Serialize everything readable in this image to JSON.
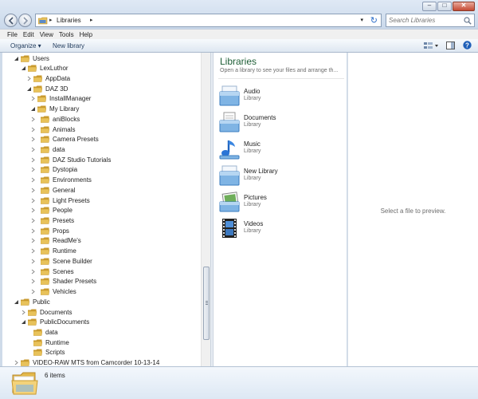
{
  "window": {
    "minimize_label": "–",
    "maximize_label": "□",
    "close_label": "✕"
  },
  "address": {
    "breadcrumb": "Libraries",
    "arrow": "▸",
    "dropdown_arrow": "▾",
    "refresh_glyph": "↻"
  },
  "search": {
    "placeholder": "Search Libraries"
  },
  "menu": [
    "File",
    "Edit",
    "View",
    "Tools",
    "Help"
  ],
  "toolbar": {
    "organize_label": "Organize ▾",
    "new_library_label": "New library"
  },
  "tree": [
    {
      "label": "Users",
      "level": 0,
      "expanded": true
    },
    {
      "label": "LexLuthor",
      "level": 1,
      "expanded": true
    },
    {
      "label": "AppData",
      "level": 2,
      "expanded": false
    },
    {
      "label": "DAZ 3D",
      "level": 2,
      "expanded": true
    },
    {
      "label": "InstallManager",
      "level": 3,
      "expanded": false
    },
    {
      "label": "My Library",
      "level": 3,
      "expanded": true
    },
    {
      "label": "aniBlocks",
      "level": 4,
      "expanded": false
    },
    {
      "label": "Animals",
      "level": 4,
      "expanded": false
    },
    {
      "label": "Camera Presets",
      "level": 4,
      "expanded": false
    },
    {
      "label": "data",
      "level": 4,
      "expanded": false
    },
    {
      "label": "DAZ Studio Tutorials",
      "level": 4,
      "expanded": false
    },
    {
      "label": "Dystopia",
      "level": 4,
      "expanded": false
    },
    {
      "label": "Environments",
      "level": 4,
      "expanded": false
    },
    {
      "label": "General",
      "level": 4,
      "expanded": false
    },
    {
      "label": "Light Presets",
      "level": 4,
      "expanded": false
    },
    {
      "label": "People",
      "level": 4,
      "expanded": false
    },
    {
      "label": "Presets",
      "level": 4,
      "expanded": false
    },
    {
      "label": "Props",
      "level": 4,
      "expanded": false
    },
    {
      "label": "ReadMe's",
      "level": 4,
      "expanded": false
    },
    {
      "label": "Runtime",
      "level": 4,
      "expanded": false
    },
    {
      "label": "Scene Builder",
      "level": 4,
      "expanded": false
    },
    {
      "label": "Scenes",
      "level": 4,
      "expanded": false
    },
    {
      "label": "Shader Presets",
      "level": 4,
      "expanded": false
    },
    {
      "label": "Vehicles",
      "level": 4,
      "expanded": false
    },
    {
      "label": "Public",
      "level": 0,
      "expanded": true
    },
    {
      "label": "Documents",
      "level": 1,
      "expanded": false
    },
    {
      "label": "PublicDocuments",
      "level": 1,
      "expanded": true
    },
    {
      "label": "data",
      "level": 2,
      "expanded": null
    },
    {
      "label": "Runtime",
      "level": 2,
      "expanded": null
    },
    {
      "label": "Scripts",
      "level": 2,
      "expanded": null
    },
    {
      "label": "VIDEO-RAW MTS from Camcorder 10-13-14",
      "level": -1,
      "expanded": false
    }
  ],
  "libraries": {
    "title": "Libraries",
    "subtitle": "Open a library to see your files and arrange th...",
    "items": [
      {
        "name": "Audio",
        "type": "Library",
        "icon": "audio-library-icon"
      },
      {
        "name": "Documents",
        "type": "Library",
        "icon": "documents-library-icon"
      },
      {
        "name": "Music",
        "type": "Library",
        "icon": "music-library-icon"
      },
      {
        "name": "New Library",
        "type": "Library",
        "icon": "new-library-icon"
      },
      {
        "name": "Pictures",
        "type": "Library",
        "icon": "pictures-library-icon"
      },
      {
        "name": "Videos",
        "type": "Library",
        "icon": "videos-library-icon"
      }
    ]
  },
  "preview": {
    "message": "Select a file to preview."
  },
  "details": {
    "item_count": "6 items"
  },
  "colors": {
    "folder": "#e8c25a",
    "folder_dark": "#c99a2e",
    "title_green": "#1e5e36",
    "accent_blue": "#2a6cc7"
  }
}
